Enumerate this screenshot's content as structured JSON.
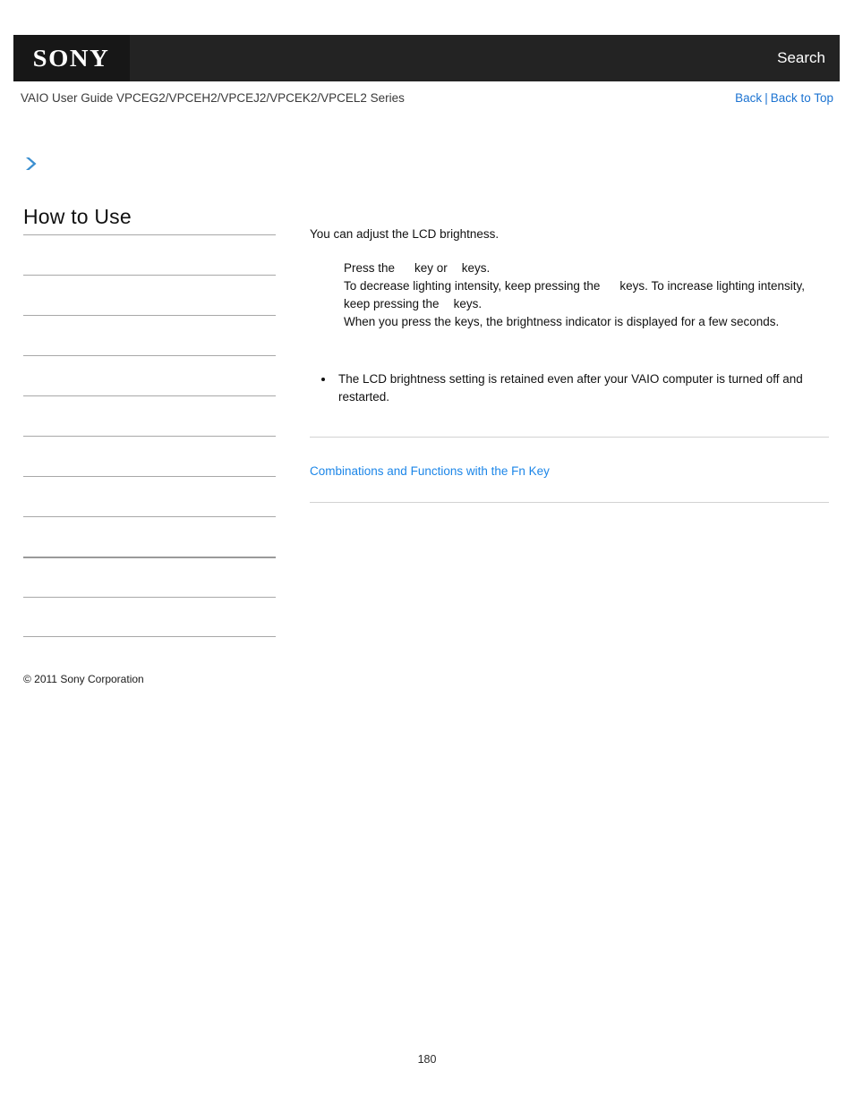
{
  "header": {
    "logo_text": "SONY",
    "search_label": "Search",
    "logo_bg": "#171717",
    "bar_bg": "#232323"
  },
  "subheader": {
    "guide_title": "VAIO User Guide VPCEG2/VPCEH2/VPCEJ2/VPCEK2/VPCEL2 Series",
    "back_label": "Back",
    "separator": "|",
    "back_to_top_label": "Back to Top",
    "link_color": "#1c73d1"
  },
  "sidebar": {
    "chevron_icon": "chevron-right-icon",
    "chevron_color": "#3b8fd0",
    "heading": "How to Use",
    "items": [
      {
        "label": ""
      },
      {
        "label": ""
      },
      {
        "label": ""
      },
      {
        "label": ""
      },
      {
        "label": ""
      },
      {
        "label": ""
      },
      {
        "label": ""
      },
      {
        "label": ""
      },
      {
        "label": ""
      },
      {
        "label": ""
      }
    ],
    "copyright": "© 2011 Sony Corporation"
  },
  "content": {
    "intro": "You can adjust the LCD brightness.",
    "steps": [
      {
        "parts": [
          "Press the",
          "key or",
          "keys."
        ],
        "gaps": [
          1,
          2
        ]
      },
      {
        "parts": [
          "To decrease lighting intensity, keep pressing the",
          "keys. To increase lighting intensity, keep pressing the",
          "keys."
        ],
        "gaps": [
          1,
          2
        ]
      },
      {
        "parts": [
          "When you press the keys, the brightness indicator is displayed for a few seconds."
        ],
        "gaps": []
      }
    ],
    "step1_pre": "Press the",
    "step1_mid": "key or",
    "step1_post": "keys.",
    "step2_pre": "To decrease lighting intensity, keep pressing the",
    "step2_mid": "keys. To increase lighting intensity, keep pressing the",
    "step2_post": "keys.",
    "step3": "When you press the keys, the brightness indicator is displayed for a few seconds.",
    "note": "The LCD brightness setting is retained even after your VAIO computer is turned off and restarted.",
    "related_link": "Combinations and Functions with the Fn Key",
    "related_link_color": "#1c86e8"
  },
  "footer": {
    "page_number": "180"
  }
}
